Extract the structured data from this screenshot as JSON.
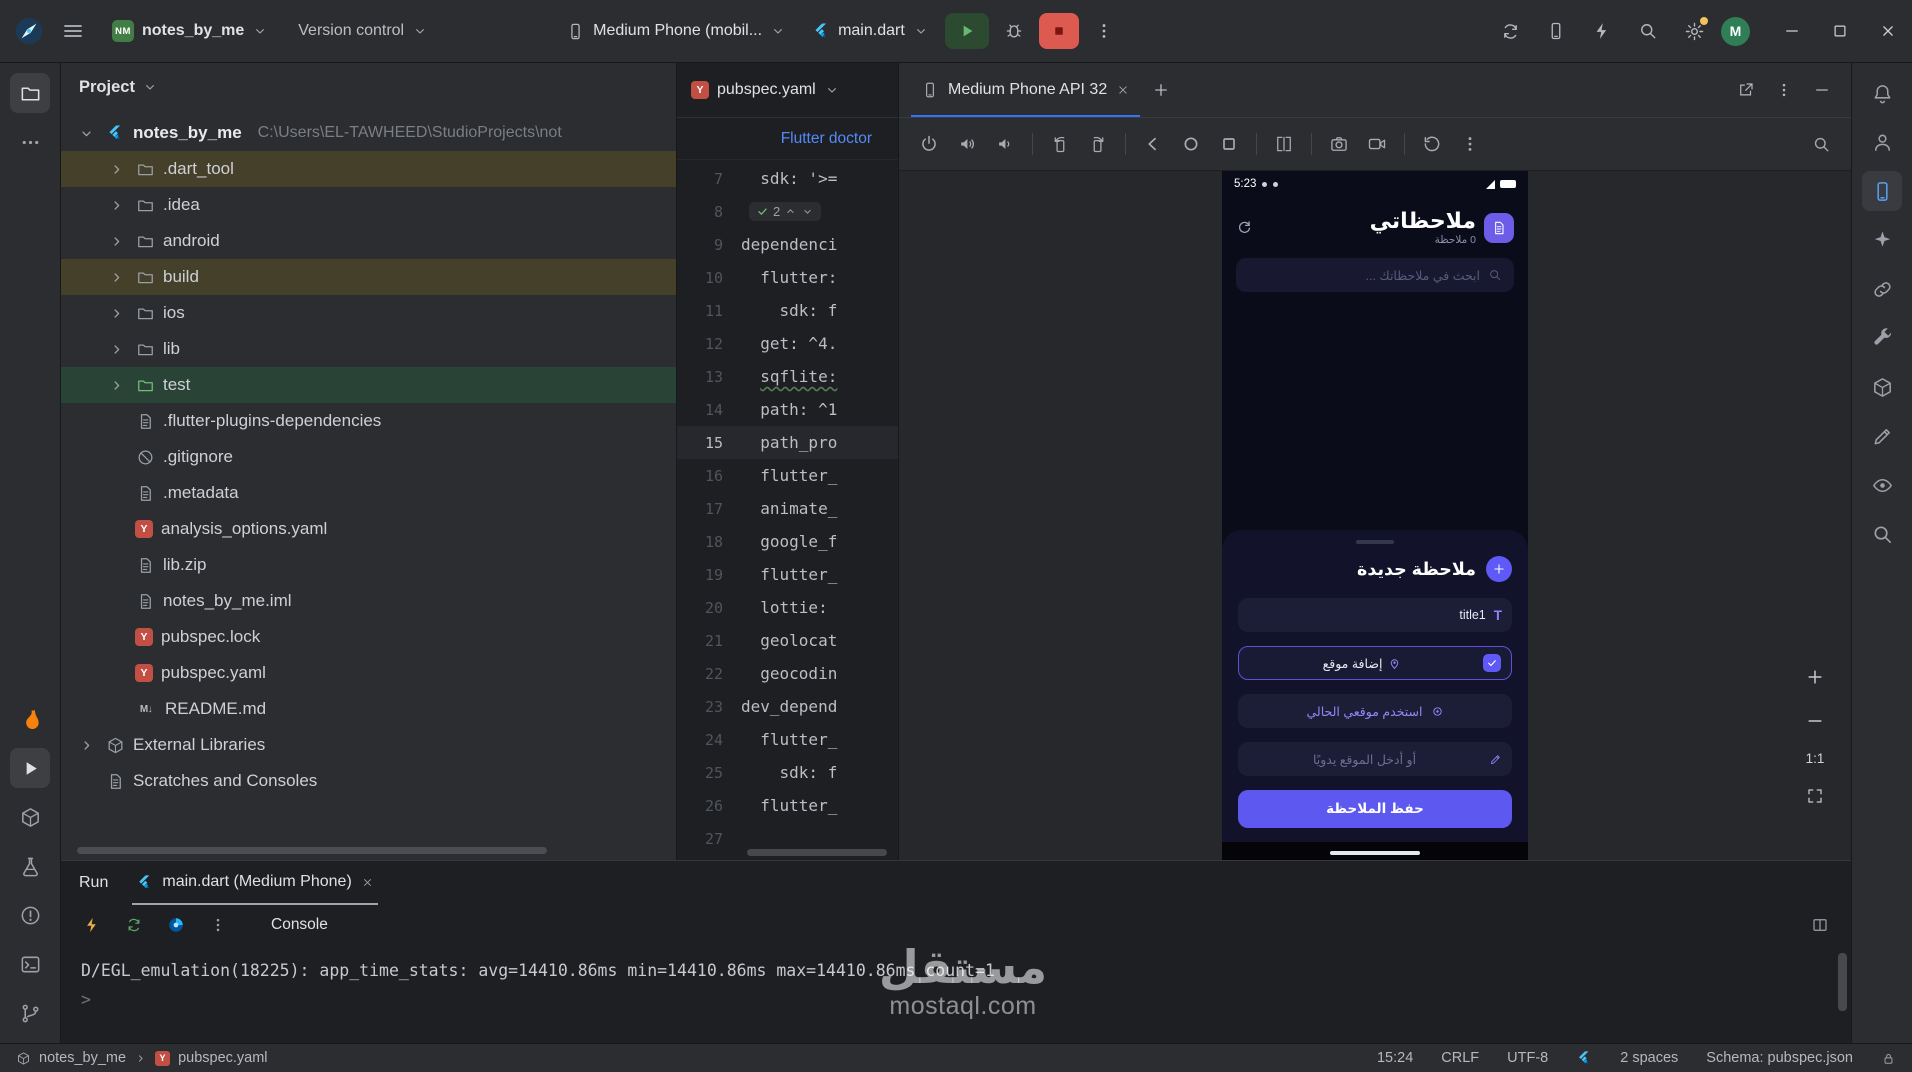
{
  "icon_glyphs": {
    "yaml": "Y",
    "markdown": "M↓",
    "text_field": "T"
  },
  "titlebar": {
    "project_badge": "NM",
    "project_name": "notes_by_me",
    "version_control": "Version control",
    "device_selector": "Medium Phone (mobil...",
    "run_config": "main.dart",
    "avatar_initial": "M"
  },
  "left_strip": [
    {
      "name": "project-tool-button",
      "icon": "i-folder",
      "active": true
    },
    {
      "name": "more-tool-windows-button",
      "icon": "i-dots-h"
    },
    {
      "spacer": true
    },
    {
      "name": "app-quality-insights-button",
      "icon": "i-flame",
      "color": "#f6820d"
    },
    {
      "name": "run-tool-button",
      "icon": "i-play",
      "active": true
    },
    {
      "name": "packages-tool-button",
      "icon": "i-box"
    },
    {
      "name": "build-tool-button",
      "icon": "i-flask"
    },
    {
      "name": "problems-tool-button",
      "icon": "i-error"
    },
    {
      "name": "terminal-tool-button",
      "icon": "i-terminal"
    },
    {
      "name": "version-control-tool-button",
      "icon": "i-branch"
    }
  ],
  "right_strip": [
    {
      "name": "notifications-button",
      "icon": "i-bell"
    },
    {
      "name": "profiler-tool-button",
      "icon": "i-person"
    },
    {
      "name": "running-devices-tool-button",
      "icon": "i-phone",
      "active": true,
      "accent": true
    },
    {
      "name": "gemini-tool-button",
      "icon": "i-sparkle"
    },
    {
      "name": "resource-manager-tool-button",
      "icon": "i-link"
    },
    {
      "name": "build-variants-tool-button",
      "icon": "i-wrench"
    },
    {
      "name": "device-explorer-tool-button",
      "icon": "i-box"
    },
    {
      "name": "compose-tool-button",
      "icon": "i-pencil"
    },
    {
      "name": "layout-inspector-tool-button",
      "icon": "i-eye"
    },
    {
      "name": "app-inspection-tool-button",
      "icon": "i-search"
    }
  ],
  "project_panel": {
    "title": "Project",
    "root_name": "notes_by_me",
    "root_path": "C:\\Users\\EL-TAWHEED\\StudioProjects\\not",
    "tree": [
      {
        "name": ".dart_tool",
        "icon": "folder",
        "chevron": true,
        "row": "excluded"
      },
      {
        "name": ".idea",
        "icon": "folder-idea",
        "chevron": true
      },
      {
        "name": "android",
        "icon": "folder",
        "chevron": true
      },
      {
        "name": "build",
        "icon": "folder-build",
        "chevron": true,
        "row": "excluded"
      },
      {
        "name": "ios",
        "icon": "folder",
        "chevron": true
      },
      {
        "name": "lib",
        "icon": "folder",
        "chevron": true
      },
      {
        "name": "test",
        "icon": "folder-test",
        "chevron": true,
        "row": "selected"
      },
      {
        "name": ".flutter-plugins-dependencies",
        "icon": "file"
      },
      {
        "name": ".gitignore",
        "icon": "ignore"
      },
      {
        "name": ".metadata",
        "icon": "file"
      },
      {
        "name": "analysis_options.yaml",
        "icon": "yaml"
      },
      {
        "name": "lib.zip",
        "icon": "archive"
      },
      {
        "name": "notes_by_me.iml",
        "icon": "iml"
      },
      {
        "name": "pubspec.lock",
        "icon": "yaml"
      },
      {
        "name": "pubspec.yaml",
        "icon": "yaml"
      },
      {
        "name": "README.md",
        "icon": "markdown"
      }
    ],
    "extra_roots": [
      {
        "name": "External Libraries",
        "icon": "lib-folder",
        "chevron": true
      },
      {
        "name": "Scratches and Consoles",
        "icon": "scratch",
        "chevron": false
      }
    ]
  },
  "editor": {
    "tab_title": "pubspec.yaml",
    "banner_link": "Flutter doctor",
    "match_count": "2",
    "lines": [
      {
        "n": "7",
        "text": "  sdk: '>="
      },
      {
        "n": "8",
        "text": "",
        "widget": true
      },
      {
        "n": "9",
        "text": "dependenci"
      },
      {
        "n": "10",
        "text": "  flutter:"
      },
      {
        "n": "11",
        "text": "    sdk: f"
      },
      {
        "n": "12",
        "text": "  get: ^4."
      },
      {
        "n": "13",
        "text": "  sqflite:",
        "squiggle": true
      },
      {
        "n": "14",
        "text": "  path: ^1"
      },
      {
        "n": "15",
        "text": "  path_pro",
        "current": true
      },
      {
        "n": "16",
        "text": "  flutter_"
      },
      {
        "n": "17",
        "text": "  animate_"
      },
      {
        "n": "18",
        "text": "  google_f"
      },
      {
        "n": "19",
        "text": "  flutter_"
      },
      {
        "n": "20",
        "text": "  lottie:"
      },
      {
        "n": "21",
        "text": "  geolocat"
      },
      {
        "n": "22",
        "text": "  geocodin"
      },
      {
        "n": "23",
        "text": "dev_depend"
      },
      {
        "n": "24",
        "text": "  flutter_"
      },
      {
        "n": "25",
        "text": "    sdk: f"
      },
      {
        "n": "26",
        "text": "  flutter_"
      },
      {
        "n": "27",
        "text": ""
      }
    ]
  },
  "devices_panel": {
    "tab_title": "Medium Phone API 32",
    "zoom_label": "1:1",
    "toolbar": [
      {
        "name": "power-button",
        "icon": "i-power"
      },
      {
        "name": "volume-up-button",
        "icon": "i-vol-up"
      },
      {
        "name": "volume-down-button",
        "icon": "i-vol-dn"
      },
      {
        "sep": true
      },
      {
        "name": "rotate-left-button",
        "icon": "i-rot-l"
      },
      {
        "name": "rotate-right-button",
        "icon": "i-rot-r"
      },
      {
        "sep": true
      },
      {
        "name": "back-button",
        "icon": "i-back"
      },
      {
        "name": "home-button",
        "icon": "i-circle"
      },
      {
        "name": "overview-button",
        "icon": "i-square"
      },
      {
        "sep": true
      },
      {
        "name": "fold-device-button",
        "icon": "i-fold"
      },
      {
        "sep": true
      },
      {
        "name": "screenshot-button",
        "icon": "i-camera"
      },
      {
        "name": "screen-record-button",
        "icon": "i-video"
      },
      {
        "sep": true
      },
      {
        "name": "snapshots-button",
        "icon": "i-restore"
      },
      {
        "name": "more-actions-button",
        "icon": "i-dots-v"
      }
    ]
  },
  "phone": {
    "time": "5:23",
    "app_title": "ملاحظاتي",
    "notes_count": "0 ملاحظة",
    "search_placeholder": "ابحث في ملاحظاتك ...",
    "sheet_title": "ملاحظة جديدة",
    "title_field_value": "title1",
    "add_location_label": "إضافة موقع",
    "use_current_location": "استخدم موقعي الحالي",
    "enter_location_manually": "أو أدخل الموقع يدويًا",
    "save_button": "حفظ الملاحظة"
  },
  "run_panel": {
    "label": "Run",
    "tab_title": "main.dart (Medium Phone)",
    "console_label": "Console",
    "console_line": "D/EGL_emulation(18225): app_time_stats: avg=14410.86ms min=14410.86ms max=14410.86ms count=1",
    "prompt": ">"
  },
  "statusbar": {
    "module": "notes_by_me",
    "file": "pubspec.yaml",
    "cursor": "15:24",
    "line_ending": "CRLF",
    "encoding": "UTF-8",
    "indent": "2 spaces",
    "schema": "Schema: pubspec.json"
  },
  "watermark": {
    "brand": "مستقل",
    "domain": "mostaql.com"
  }
}
